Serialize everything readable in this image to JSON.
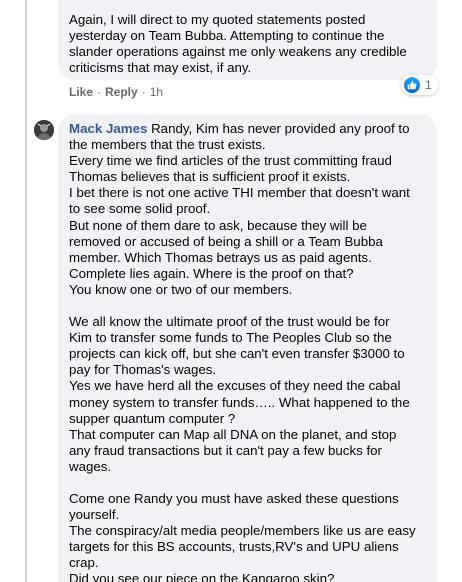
{
  "reply_comment": {
    "text": "Again, I will direct to my quoted statements posted\nyesterday on Team Bubba. Attempting to continue the\nslander operations against me only weakens any credible\ncriticisms that may exist, if any.",
    "actions": {
      "like": "Like",
      "reply": "Reply",
      "separator": "·",
      "time": "1h"
    },
    "reactions": {
      "icon": "like-thumbs-up-icon",
      "count": "1",
      "color": "#1877f2"
    }
  },
  "main_comment": {
    "author": "Mack James",
    "avatar_icon": "user-avatar",
    "first_line": " Randy, Kim has never provided any proof to\nthe members that the trust exists.",
    "paragraph_1": "Every time we find articles of the trust committing fraud\nThomas believes that is sufficient proof it exists.\nI bet there is not one active THI member that doesn't want\nto see some solid proof.\nBut none of them dare to ask, because they will be\nremoved or accused of being a shill or a Team Bubba\nmember. Which Thomas betrays us as paid agents.\nComplete lies again. Where is the proof on that?\nYou know one or two of our members.",
    "paragraph_2": "We all know the ultimate proof of the trust would be for\nKim to transfer some funds to The Peoples Club so the\nprojects can kick off, but she can't even transfer $3000 to\npay for Thomas's wages.\nYes we have herd all the excuses of they need the cabal\nmoney system to transfer funds….. What happened to the\nsupper quantum computer ?\nThat computer can Map all DNA on the planet, and stop\nany fraud transactions but it can't pay a few bucks for\nwages.",
    "paragraph_3": "Come one Randy you must have asked these questions\nyourself.\nThe conspiracy/alt media people/members like us are easy\ntargets for this BS accounts, trusts,RV's and UPU aliens\ncrap.\nDid you see our piece on the Kangaroo skin?"
  },
  "colors": {
    "bubble": "#f0f2f5",
    "author_link": "#385898",
    "meta_text": "#65676b",
    "thread_line": "#ced0d4"
  }
}
